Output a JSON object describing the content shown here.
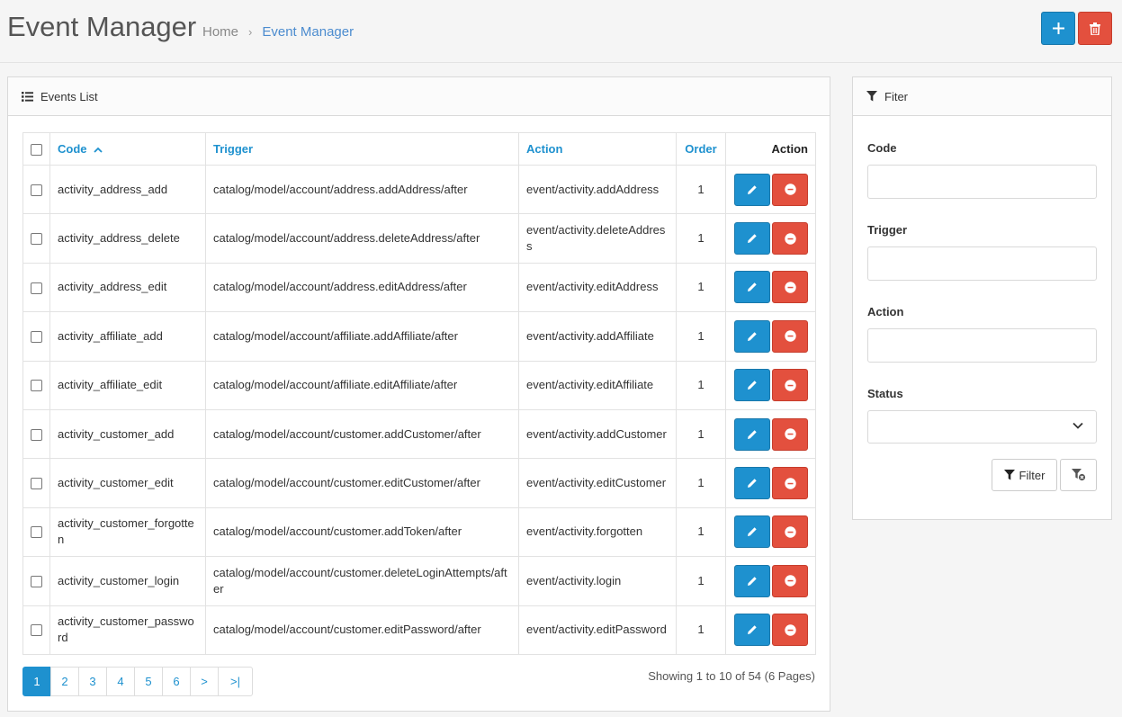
{
  "header": {
    "title": "Event Manager",
    "breadcrumb": {
      "home": "Home",
      "separator": "›",
      "current": "Event Manager"
    },
    "add_button_icon": "plus-icon",
    "delete_button_icon": "trash-icon"
  },
  "events_panel": {
    "heading": "Events List",
    "columns": {
      "code": "Code",
      "trigger": "Trigger",
      "action": "Action",
      "order": "Order",
      "actions": "Action"
    },
    "rows": [
      {
        "code": "activity_address_add",
        "trigger": "catalog/model/account/address.addAddress/after",
        "action": "event/activity.addAddress",
        "order": "1"
      },
      {
        "code": "activity_address_delete",
        "trigger": "catalog/model/account/address.deleteAddress/after",
        "action": "event/activity.deleteAddress",
        "order": "1"
      },
      {
        "code": "activity_address_edit",
        "trigger": "catalog/model/account/address.editAddress/after",
        "action": "event/activity.editAddress",
        "order": "1"
      },
      {
        "code": "activity_affiliate_add",
        "trigger": "catalog/model/account/affiliate.addAffiliate/after",
        "action": "event/activity.addAffiliate",
        "order": "1"
      },
      {
        "code": "activity_affiliate_edit",
        "trigger": "catalog/model/account/affiliate.editAffiliate/after",
        "action": "event/activity.editAffiliate",
        "order": "1"
      },
      {
        "code": "activity_customer_add",
        "trigger": "catalog/model/account/customer.addCustomer/after",
        "action": "event/activity.addCustomer",
        "order": "1"
      },
      {
        "code": "activity_customer_edit",
        "trigger": "catalog/model/account/customer.editCustomer/after",
        "action": "event/activity.editCustomer",
        "order": "1"
      },
      {
        "code": "activity_customer_forgotten",
        "trigger": "catalog/model/account/customer.addToken/after",
        "action": "event/activity.forgotten",
        "order": "1"
      },
      {
        "code": "activity_customer_login",
        "trigger": "catalog/model/account/customer.deleteLoginAttempts/after",
        "action": "event/activity.login",
        "order": "1"
      },
      {
        "code": "activity_customer_password",
        "trigger": "catalog/model/account/customer.editPassword/after",
        "action": "event/activity.editPassword",
        "order": "1"
      }
    ],
    "pagination": [
      "1",
      "2",
      "3",
      "4",
      "5",
      "6",
      ">",
      ">|"
    ],
    "active_page": "1",
    "results": "Showing 1 to 10 of 54 (6 Pages)"
  },
  "filter_panel": {
    "heading": "Fiter",
    "code_label": "Code",
    "code_value": "",
    "trigger_label": "Trigger",
    "trigger_value": "",
    "action_label": "Action",
    "action_value": "",
    "status_label": "Status",
    "status_selected": "",
    "filter_button": "Filter"
  },
  "colors": {
    "primary": "#1e91cf",
    "danger": "#e3503e"
  }
}
